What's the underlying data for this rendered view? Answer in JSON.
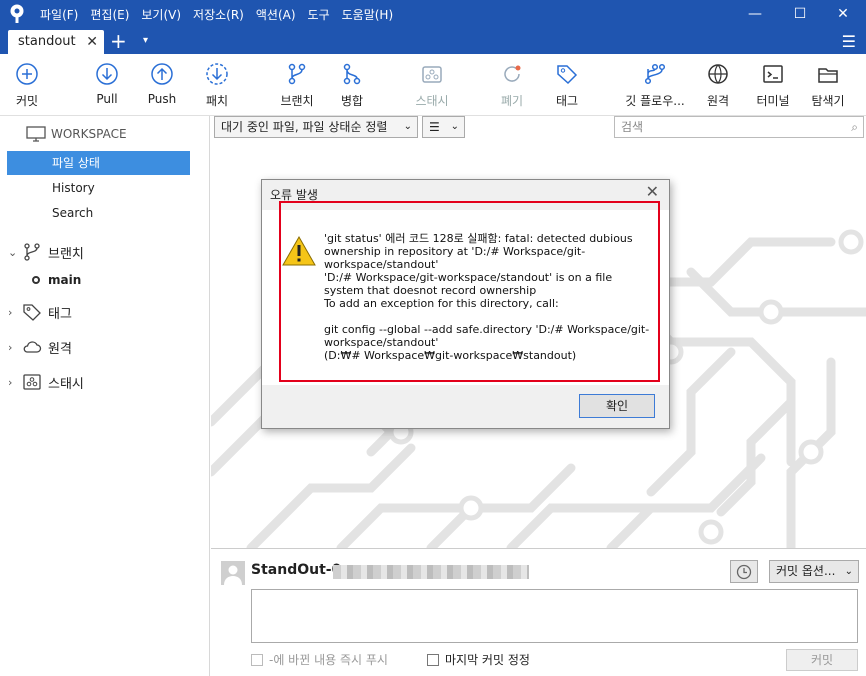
{
  "titlebar": {
    "menu": [
      "파일(F)",
      "편집(E)",
      "보기(V)",
      "저장소(R)",
      "액션(A)",
      "도구",
      "도움말(H)"
    ],
    "minimize": "—",
    "maximize": "☐",
    "close": "✕"
  },
  "tabs": [
    {
      "label": "standout",
      "close": "✕"
    }
  ],
  "tab_add": "+",
  "tab_dropdown": "▾",
  "menu_icon": "☰",
  "toolbar": {
    "commit": "커밋",
    "pull": "Pull",
    "push": "Push",
    "patch": "패치",
    "branch": "브랜치",
    "merge": "병합",
    "stash": "스태시",
    "discard": "폐기",
    "tag": "태그",
    "git_flow": "깃 플로우...",
    "remote": "원격",
    "terminal": "터미널",
    "explorer": "탐색기"
  },
  "sidebar": {
    "workspace": "WORKSPACE",
    "file_status": "파일 상태",
    "history": "History",
    "search": "Search",
    "branches": "브랜치",
    "current_branch": "main",
    "tags": "태그",
    "remotes": "원격",
    "stashes": "스태시"
  },
  "filter": {
    "sort_label": "대기 중인 파일, 파일 상태순 정렬",
    "view_icon": "☰",
    "search_placeholder": "검색"
  },
  "dialog": {
    "title": "오류 발생",
    "close": "✕",
    "message": "'git status' 에러 코드 128로 실패함: fatal: detected dubious ownership in repository at 'D:/# Workspace/git-workspace/standout'\n'D:/# Workspace/git-workspace/standout' is on a file system that doesnot record ownership\nTo add an exception for this directory, call:\n\n                  git config --global --add safe.directory 'D:/# Workspace/git-workspace/standout'\n (D:₩# Workspace₩git-workspace₩standout)",
    "ok": "확인"
  },
  "commit": {
    "author": "StandOut-0",
    "commit_options": "커밋 옵션...",
    "push_now": "-에 바뀐 내용 즉시 푸시",
    "amend": "마지막 커밋 정정",
    "commit_button": "커밋"
  },
  "colors": {
    "accent": "#1f55b0",
    "selection": "#3d8ee0",
    "error_border": "#e3001b"
  }
}
